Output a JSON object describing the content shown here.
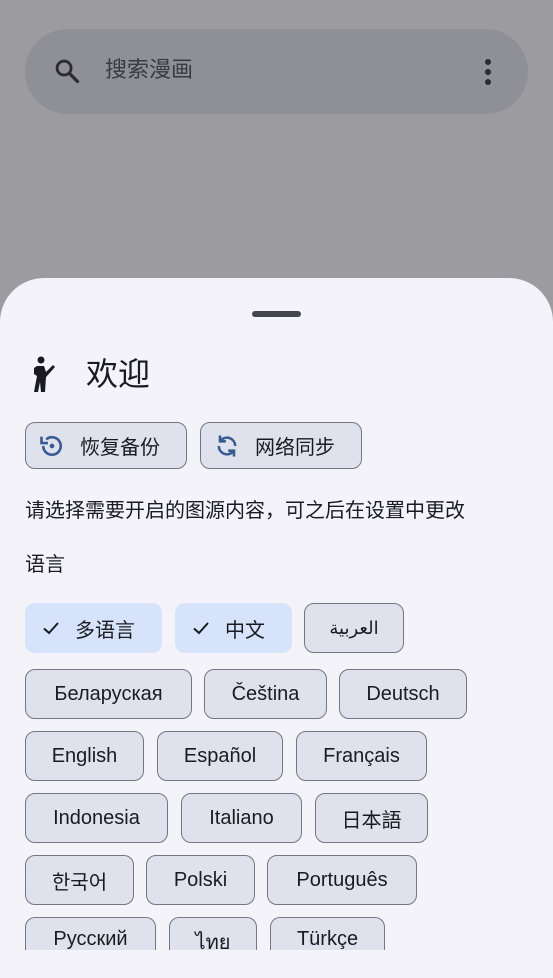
{
  "search": {
    "placeholder": "搜索漫画",
    "icon": "search-icon",
    "menu_icon": "more-vert-icon"
  },
  "sheet": {
    "title": "欢迎",
    "title_icon": "welcome-person-icon",
    "buttons": [
      {
        "label": "恢复备份",
        "icon": "restore-backup-icon"
      },
      {
        "label": "网络同步",
        "icon": "sync-icon"
      }
    ],
    "description": "请选择需要开启的图源内容，可之后在设置中更改",
    "language_label": "语言",
    "languages": [
      {
        "label": "多语言",
        "selected": true
      },
      {
        "label": "中文",
        "selected": true
      },
      {
        "label": "العربية",
        "selected": false
      },
      {
        "label": "Беларуская",
        "selected": false
      },
      {
        "label": "Čeština",
        "selected": false
      },
      {
        "label": "Deutsch",
        "selected": false
      },
      {
        "label": "English",
        "selected": false
      },
      {
        "label": "Español",
        "selected": false
      },
      {
        "label": "Français",
        "selected": false
      },
      {
        "label": "Indonesia",
        "selected": false
      },
      {
        "label": "Italiano",
        "selected": false
      },
      {
        "label": "日本語",
        "selected": false
      },
      {
        "label": "한국어",
        "selected": false
      },
      {
        "label": "Polski",
        "selected": false
      },
      {
        "label": "Português",
        "selected": false
      },
      {
        "label": "Русский",
        "selected": false
      },
      {
        "label": "ไทย",
        "selected": false
      },
      {
        "label": "Türkçe",
        "selected": false
      }
    ]
  },
  "colors": {
    "accent": "#3a5a92",
    "selected_chip": "#d6e3fb",
    "chip": "#dfe2ec",
    "sheet": "#f3f3f9"
  }
}
